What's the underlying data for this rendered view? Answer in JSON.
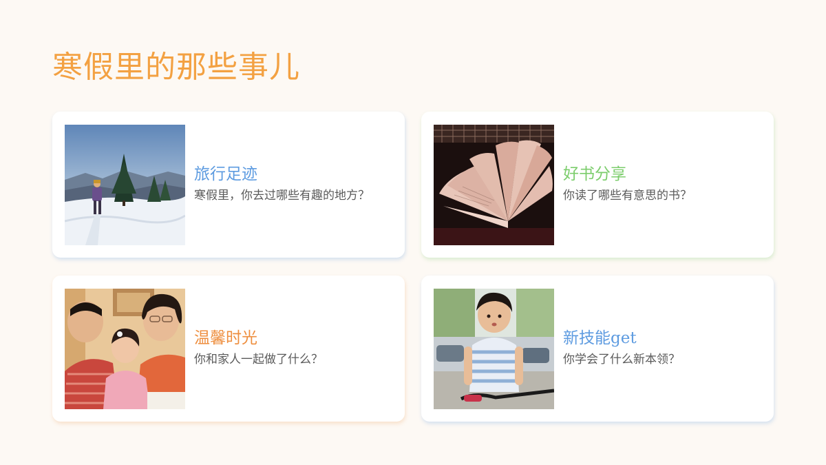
{
  "page": {
    "title": "寒假里的那些事儿",
    "title_color": "#f3a142"
  },
  "cards": [
    {
      "title": "旅行足迹",
      "desc": "寒假里，你去过哪些有趣的地方？",
      "title_color": "#5d9be0",
      "image": "snow-hiker-photo"
    },
    {
      "title": "好书分享",
      "desc": "你读了哪些有意思的书？",
      "title_color": "#7ccd6c",
      "image": "open-book-photo"
    },
    {
      "title": "温馨时光",
      "desc": "你和家人一起做了什么？",
      "title_color": "#ee8e3e",
      "image": "family-photo"
    },
    {
      "title": "新技能get",
      "desc": "你学会了什么新本领？",
      "title_color": "#5d9be0",
      "image": "boy-bicycle-photo"
    }
  ]
}
